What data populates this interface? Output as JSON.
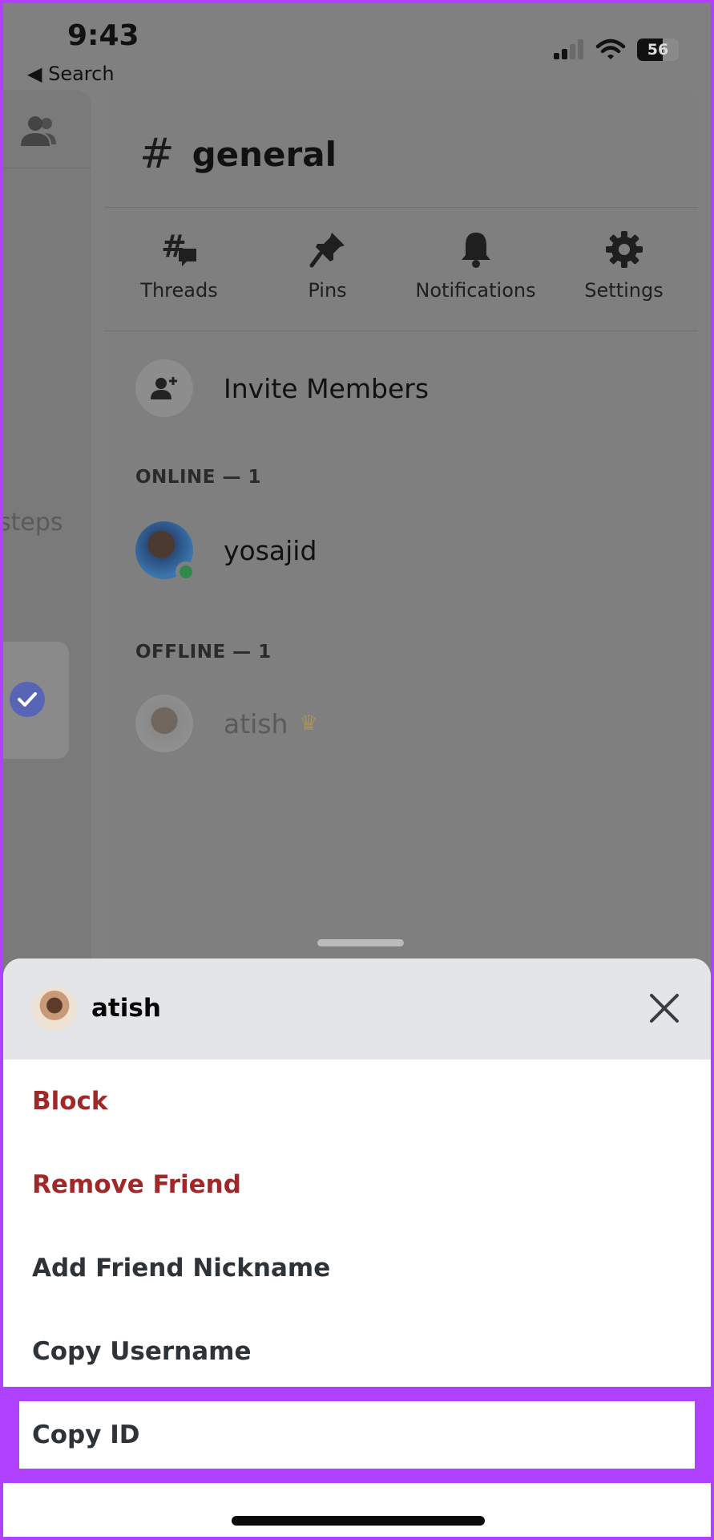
{
  "status_bar": {
    "time": "9:43",
    "back_label": "◀ Search",
    "battery": "56"
  },
  "left_rail": {
    "partial_text": "steps"
  },
  "channel": {
    "name": "general",
    "actions": [
      {
        "label": "Threads",
        "icon": "threads-icon"
      },
      {
        "label": "Pins",
        "icon": "pin-icon"
      },
      {
        "label": "Notifications",
        "icon": "bell-icon"
      },
      {
        "label": "Settings",
        "icon": "gear-icon"
      }
    ],
    "invite_label": "Invite Members",
    "online_label": "ONLINE — 1",
    "offline_label": "OFFLINE — 1",
    "online_members": [
      {
        "name": "yosajid"
      }
    ],
    "offline_members": [
      {
        "name": "atish"
      }
    ]
  },
  "sheet": {
    "title": "atish",
    "items": [
      {
        "label": "Block",
        "danger": true
      },
      {
        "label": "Remove Friend",
        "danger": true
      },
      {
        "label": "Add Friend Nickname",
        "danger": false
      },
      {
        "label": "Copy Username",
        "danger": false
      },
      {
        "label": "Copy ID",
        "danger": false,
        "highlighted": true
      }
    ]
  },
  "colors": {
    "highlight": "#b042ff",
    "danger": "#a12828",
    "presence_online": "#2e8b4a",
    "check_badge": "#5865b5"
  }
}
